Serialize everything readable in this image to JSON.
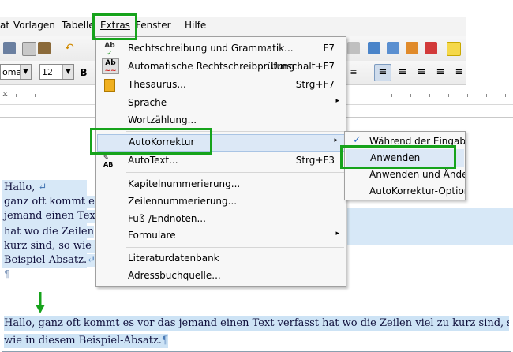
{
  "menubar": {
    "items": [
      "at",
      "Vorlagen",
      "Tabelle",
      "Extras",
      "Fenster",
      "Hilfe"
    ]
  },
  "toolbar": {
    "font_name": "oma",
    "font_size": "12"
  },
  "extras_menu": {
    "items": [
      {
        "label": "Rechtschreibung und Grammatik...",
        "shortcut": "F7"
      },
      {
        "label": "Automatische Rechtschreibprüfung",
        "shortcut": "Umschalt+F7"
      },
      {
        "label": "Thesaurus...",
        "shortcut": "Strg+F7"
      },
      {
        "label": "Sprache",
        "submenu": "▸"
      },
      {
        "label": "Wortzählung..."
      },
      {
        "label": "AutoKorrektur",
        "submenu": "▸"
      },
      {
        "label": "AutoText...",
        "shortcut": "Strg+F3"
      },
      {
        "label": "Kapitelnummerierung..."
      },
      {
        "label": "Zeilennummerierung..."
      },
      {
        "label": "Fuß-/Endnoten..."
      },
      {
        "label": "Formulare",
        "submenu": "▸"
      },
      {
        "label": "Literaturdatenbank"
      },
      {
        "label": "Adressbuchquelle..."
      }
    ]
  },
  "autokorrektur_submenu": {
    "items": [
      {
        "label": "Während der Eingabe",
        "checked": "✓"
      },
      {
        "label": "Anwenden"
      },
      {
        "label": "Anwenden und Änderungen bearbeiten"
      },
      {
        "label": "AutoKorrektur-Optionen..."
      }
    ]
  },
  "document": {
    "before_lines": [
      "Hallo,",
      "ganz oft kommt es",
      "jemand einen Text",
      "hat wo die Zeilen",
      "kurz sind, so wie i",
      "Beispiel-Absatz."
    ],
    "pilcrow": "¶",
    "linebreak": "↵",
    "after_lines": [
      "Hallo, ganz oft kommt es vor das jemand einen Text verfasst hat wo die Zeilen viel zu kurz sind, so",
      "wie in diesem Beispiel-Absatz."
    ]
  },
  "colors": {
    "highlight_green": "#16a31b",
    "menu_hover": "#dce8f6",
    "selection": "#d7e8f7"
  }
}
